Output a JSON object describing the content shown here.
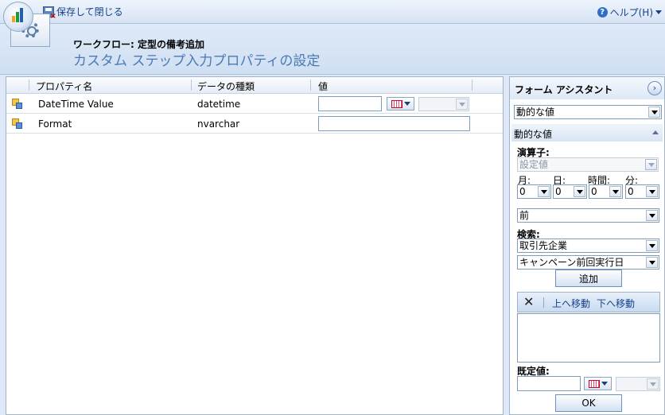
{
  "toolbar": {
    "save_close_label": "保存して閉じる",
    "help_label": "ヘルプ(H)"
  },
  "header": {
    "subtitle": "ワークフロー: 定型の備考追加",
    "title": "カスタム ステップ入力プロパティの設定"
  },
  "grid": {
    "columns": [
      "プロパティ名",
      "データの種類",
      "値"
    ],
    "rows": [
      {
        "name": "DateTime Value",
        "type": "datetime"
      },
      {
        "name": "Format",
        "type": "nvarchar"
      }
    ]
  },
  "panel": {
    "title": "フォーム アシスタント",
    "top_select": "動的な値",
    "section_title": "動的な値",
    "operator_label": "演算子:",
    "operator_value": "設定値",
    "time_labels": [
      "月:",
      "日:",
      "時間:",
      "分:"
    ],
    "time_values": [
      "0",
      "0",
      "0",
      "0"
    ],
    "direction_value": "前",
    "search_label": "検索:",
    "search_entity": "取引先企業",
    "search_field": "キャンペーン前回実行日",
    "add_button": "追加",
    "move_up": "上へ移動",
    "move_down": "下へ移動",
    "default_label": "既定値:",
    "ok_button": "OK"
  },
  "colors": {
    "accent": "#15428b",
    "title_blue": "#4a7ab5",
    "frame": "#9fb4cc"
  },
  "icons": [
    "app-logo-icon",
    "save-close-icon",
    "help-icon",
    "workflow-gear-icon",
    "property-icon",
    "calendar-icon",
    "expand-icon",
    "collapse-icon",
    "delete-icon"
  ]
}
